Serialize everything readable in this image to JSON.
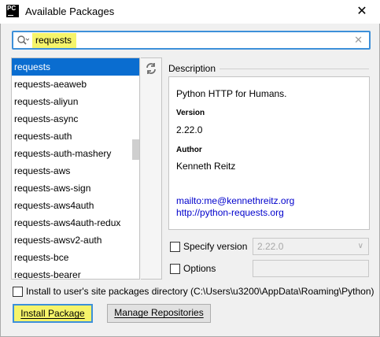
{
  "window": {
    "title": "Available Packages"
  },
  "search": {
    "query": "requests"
  },
  "packages": [
    "requests",
    "requests-aeaweb",
    "requests-aliyun",
    "requests-async",
    "requests-auth",
    "requests-auth-mashery",
    "requests-aws",
    "requests-aws-sign",
    "requests-aws4auth",
    "requests-aws4auth-redux",
    "requests-awsv2-auth",
    "requests-bce",
    "requests-bearer"
  ],
  "selected_package": "requests",
  "description": {
    "label": "Description",
    "summary": "Python HTTP for Humans.",
    "version_heading": "Version",
    "version": "2.22.0",
    "author_heading": "Author",
    "author": "Kenneth Reitz",
    "email_link": "mailto:me@kennethreitz.org",
    "url_link": "http://python-requests.org"
  },
  "options": {
    "specify_version_label": "Specify version",
    "specify_version_value": "2.22.0",
    "options_label": "Options",
    "site_packages_label": "Install to user's site packages directory (C:\\Users\\u3200\\AppData\\Roaming\\Python)"
  },
  "buttons": {
    "install": "Install Package",
    "manage": "Manage Repositories"
  },
  "colors": {
    "selection": "#0a6dd0",
    "highlight": "#f6f46a",
    "focus_border": "#3d90d9",
    "link": "#0000cc"
  }
}
